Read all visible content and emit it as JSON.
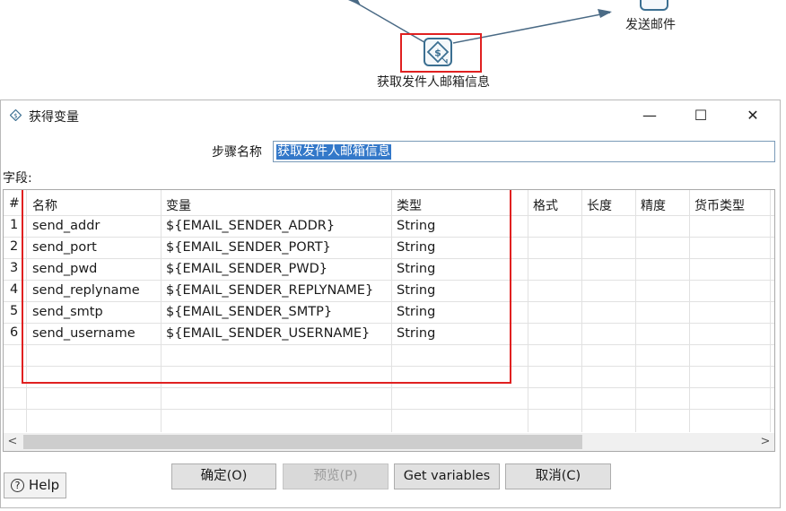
{
  "canvas": {
    "node_send_mail": "发送邮件",
    "node_get_sender": "获取发件人邮箱信息"
  },
  "dialog": {
    "title": "获得变量",
    "minimize": "—",
    "maximize": "☐",
    "close": "✕",
    "step_name_label": "步骤名称",
    "step_name_value": "获取发件人邮箱信息",
    "fields_label": "字段:"
  },
  "table": {
    "headers": [
      "#",
      "名称",
      "变量",
      "类型",
      "格式",
      "长度",
      "精度",
      "货币类型"
    ],
    "rows": [
      {
        "num": "1",
        "name": "send_addr",
        "variable": "${EMAIL_SENDER_ADDR}",
        "type": "String"
      },
      {
        "num": "2",
        "name": "send_port",
        "variable": "${EMAIL_SENDER_PORT}",
        "type": "String"
      },
      {
        "num": "3",
        "name": "send_pwd",
        "variable": "${EMAIL_SENDER_PWD}",
        "type": "String"
      },
      {
        "num": "4",
        "name": "send_replyname",
        "variable": "${EMAIL_SENDER_REPLYNAME}",
        "type": "String"
      },
      {
        "num": "5",
        "name": "send_smtp",
        "variable": "${EMAIL_SENDER_SMTP}",
        "type": "String"
      },
      {
        "num": "6",
        "name": "send_username",
        "variable": "${EMAIL_SENDER_USERNAME}",
        "type": "String"
      }
    ],
    "scroll_left": "<",
    "scroll_right": ">"
  },
  "buttons": {
    "ok": "确定(O)",
    "preview": "预览(P)",
    "get_variables": "Get variables",
    "cancel": "取消(C)",
    "help": "Help"
  },
  "colors": {
    "highlight": "#e02020",
    "selection": "#3378c9"
  }
}
